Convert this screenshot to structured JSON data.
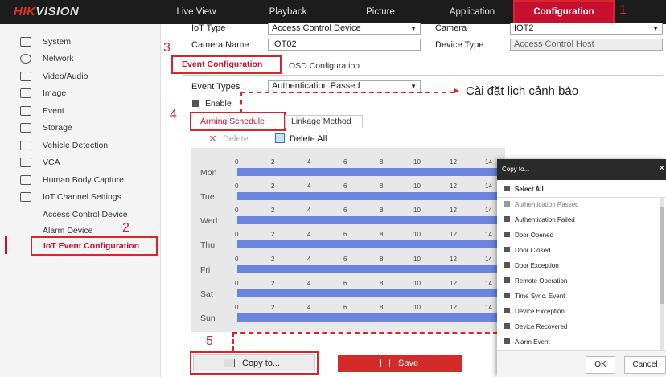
{
  "logo": {
    "part1": "HIK",
    "part2": "VISION"
  },
  "nav": {
    "live_view": "Live View",
    "playback": "Playback",
    "picture": "Picture",
    "application": "Application",
    "configuration": "Configuration"
  },
  "steps": {
    "s1": "1",
    "s2": "2",
    "s3": "3",
    "s4": "4",
    "s5": "5"
  },
  "sidebar": {
    "items": [
      {
        "label": "System",
        "icon": "monitor-icon"
      },
      {
        "label": "Network",
        "icon": "globe-icon"
      },
      {
        "label": "Video/Audio",
        "icon": "camera-icon"
      },
      {
        "label": "Image",
        "icon": "image-icon"
      },
      {
        "label": "Event",
        "icon": "calendar-icon"
      },
      {
        "label": "Storage",
        "icon": "storage-icon"
      },
      {
        "label": "Vehicle Detection",
        "icon": "car-icon"
      },
      {
        "label": "VCA",
        "icon": "vca-icon"
      },
      {
        "label": "Human Body Capture",
        "icon": "person-icon"
      },
      {
        "label": "IoT Channel Settings",
        "icon": "iot-icon"
      }
    ],
    "sub": {
      "access": "Access Control Device",
      "alarm": "Alarm Device",
      "iot_event": "IoT Event Configuration"
    }
  },
  "form": {
    "iot_type_label": "IoT Type",
    "iot_type_value": "Access Control Device",
    "camera_label": "Camera",
    "camera_value": "IOT2",
    "camera_name_label": "Camera Name",
    "camera_name_value": "IOT02",
    "device_type_label": "Device Type",
    "device_type_value": "Access Control Host"
  },
  "tabs": {
    "event_config": "Event Configuration",
    "osd_config": "OSD Configuration"
  },
  "event": {
    "types_label": "Event Types",
    "types_value": "Authentication Passed",
    "enable_label": "Enable",
    "annotation": "Cài đặt lịch cảnh báo"
  },
  "subtabs": {
    "arming": "Arming Schedule",
    "linkage": "Linkage Method"
  },
  "schedule": {
    "delete": "Delete",
    "delete_all": "Delete All",
    "days": [
      "Mon",
      "Tue",
      "Wed",
      "Thu",
      "Fri",
      "Sat",
      "Sun"
    ],
    "ticks": [
      "0",
      "2",
      "4",
      "6",
      "8",
      "10",
      "12",
      "14"
    ]
  },
  "buttons": {
    "copy_to": "Copy to...",
    "save": "Save"
  },
  "popup": {
    "title": "Copy to...",
    "close": "×",
    "select_all": "Select All",
    "items": [
      "Authentication Passed",
      "Authentication Failed",
      "Door Opened",
      "Door Closed",
      "Door Exception",
      "Remote Operation",
      "Time Sync. Event",
      "Device Exception",
      "Device Recovered",
      "Alarm Event"
    ],
    "ok": "OK",
    "cancel": "Cancel"
  },
  "colors": {
    "accent": "#c8102e",
    "bar": "#6c84de",
    "topbar": "#1c1c1c"
  }
}
